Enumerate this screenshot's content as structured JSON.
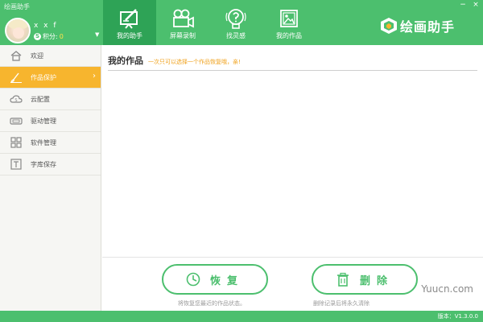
{
  "window": {
    "title": "绘画助手",
    "minimize": "−",
    "close": "×"
  },
  "user": {
    "name": "x x f",
    "points_label": "积分:",
    "points_value": "0",
    "coin_glyph": "S"
  },
  "nav": {
    "tabs": [
      {
        "label": "我的助手",
        "icon": "easel-pen-icon",
        "active": true
      },
      {
        "label": "屏幕录制",
        "icon": "video-camera-icon",
        "active": false
      },
      {
        "label": "找灵感",
        "icon": "lightbulb-question-icon",
        "active": false
      },
      {
        "label": "我的作品",
        "icon": "picture-frame-icon",
        "active": false
      }
    ]
  },
  "brand": {
    "name": "绘画助手"
  },
  "sidebar": {
    "items": [
      {
        "label": "欢迎",
        "icon": "home-icon",
        "active": false
      },
      {
        "label": "作品保护",
        "icon": "brush-icon",
        "active": true
      },
      {
        "label": "云配置",
        "icon": "cloud-icon",
        "active": false
      },
      {
        "label": "驱动管理",
        "icon": "tablet-icon",
        "active": false
      },
      {
        "label": "软件管理",
        "icon": "grid-icon",
        "active": false
      },
      {
        "label": "字库保存",
        "icon": "font-icon",
        "active": false
      }
    ]
  },
  "main": {
    "title": "我的作品",
    "hint": "一次只可以选择一个作品恢复哦，亲!",
    "restore": {
      "label": "恢复",
      "hint": "将恢复您最近的作品状态。"
    },
    "delete": {
      "label": "删除",
      "hint": "删除记录后将永久清除"
    }
  },
  "watermark": "Yuucn.com",
  "status": {
    "version": "版本：V1.3.0.0"
  },
  "colors": {
    "primary_green": "#4cbf6e",
    "active_tab_green": "#2ea356",
    "sidebar_active": "#f7b52e",
    "hint_orange": "#f0a21c"
  }
}
